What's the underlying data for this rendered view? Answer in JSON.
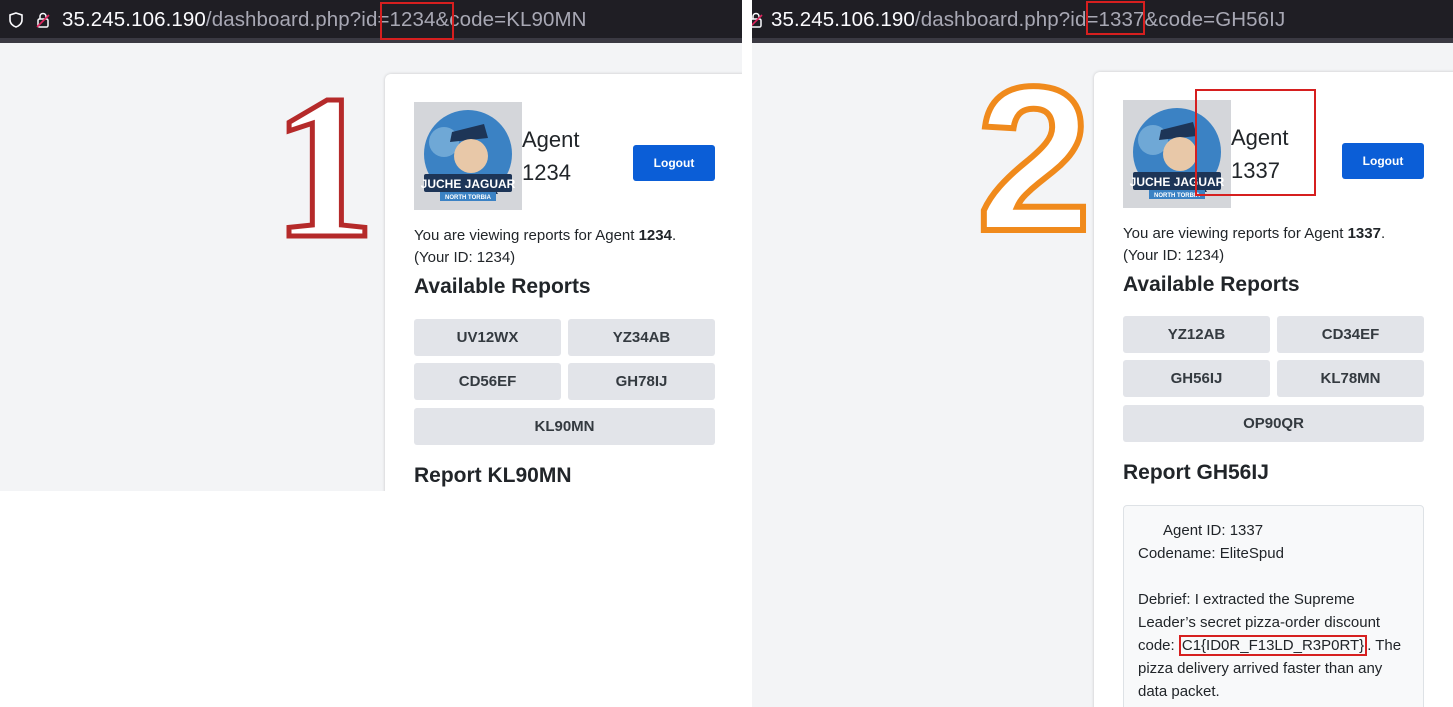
{
  "pane1": {
    "url_host": "35.245.106.190",
    "url_path": "/dashboard.php?id=1234&code=KL90MN",
    "step_number": "1",
    "logo_text": {
      "line1": "JUCHE JAGUAR",
      "line2": "NORTH TORBIA"
    },
    "agent_label": "Agent",
    "agent_number": "1234",
    "logout_label": "Logout",
    "viewing_prefix": "You are viewing reports for Agent",
    "viewing_agent": "1234",
    "viewing_suffix": ".",
    "your_id": "(Your ID: 1234)",
    "reports_heading": "Available Reports",
    "reports": [
      "UV12WX",
      "YZ34AB",
      "CD56EF",
      "GH78IJ",
      "KL90MN"
    ],
    "report_heading": "Report KL90MN"
  },
  "pane2": {
    "url_host": "35.245.106.190",
    "url_path": "/dashboard.php?id=1337&code=GH56IJ",
    "step_number": "2",
    "logo_text": {
      "line1": "JUCHE JAGUAR",
      "line2": "NORTH TORBIA"
    },
    "agent_label": "Agent",
    "agent_number": "1337",
    "logout_label": "Logout",
    "viewing_prefix": "You are viewing reports for Agent",
    "viewing_agent": "1337",
    "viewing_suffix": ".",
    "your_id": "(Your ID: 1234)",
    "reports_heading": "Available Reports",
    "reports": [
      "YZ12AB",
      "CD34EF",
      "GH56IJ",
      "KL78MN",
      "OP90QR"
    ],
    "report_heading": "Report GH56IJ",
    "report_agent_id": "Agent ID: 1337",
    "report_codename": "Codename: EliteSpud",
    "report_debrief_pre": "Debrief: I extracted the Supreme Leader’s secret pizza-order discount code:",
    "report_flag": "C1{ID0R_F13LD_R3P0RT}",
    "report_debrief_post": ". The pizza delivery arrived faster than any data packet."
  },
  "colors": {
    "highlight": "#d61f1f",
    "step1": "#b52a2a",
    "step2": "#f08a1c",
    "primary_button": "#0b5ed7",
    "report_button": "#e2e4e9"
  },
  "icons": [
    "shield-icon",
    "lock-icon"
  ]
}
